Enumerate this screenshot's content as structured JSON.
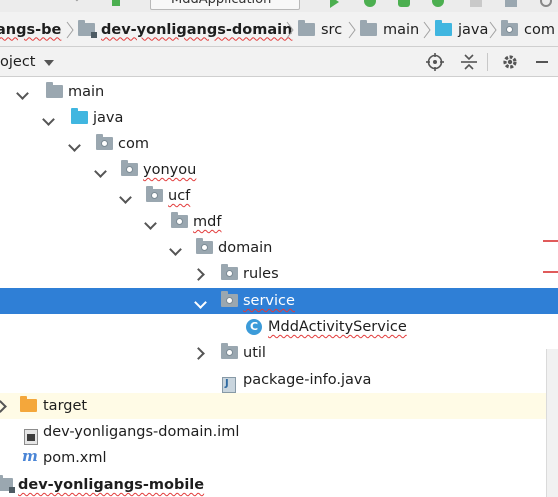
{
  "toolbar": {
    "run_config": "MddApplication"
  },
  "breadcrumb": {
    "items": [
      "angs-be",
      "dev-yonligangs-domain",
      "src",
      "main",
      "java",
      "com"
    ]
  },
  "project_panel": {
    "title": "oject",
    "actions": [
      "crosshair-icon",
      "collapse-icon",
      "gear-icon",
      "hide-icon"
    ]
  },
  "tree": {
    "rows": [
      {
        "label": "main",
        "expanded": true
      },
      {
        "label": "java",
        "expanded": true
      },
      {
        "label": "com",
        "expanded": true
      },
      {
        "label": "yonyou",
        "expanded": true
      },
      {
        "label": "ucf",
        "expanded": true
      },
      {
        "label": "mdf",
        "expanded": true
      },
      {
        "label": "domain",
        "expanded": true
      },
      {
        "label": "rules",
        "expanded": false
      },
      {
        "label": "service",
        "expanded": true,
        "selected": true
      },
      {
        "label": "MddActivityService"
      },
      {
        "label": "util",
        "expanded": false
      },
      {
        "label": "package-info.java"
      },
      {
        "label": "target",
        "expanded": false
      },
      {
        "label": "dev-yonligangs-domain.iml"
      },
      {
        "label": "pom.xml"
      },
      {
        "label": "dev-yonligangs-mobile"
      }
    ]
  },
  "colors": {
    "selection": "#2f7fd6",
    "source_folder": "#40b6e0",
    "excluded_folder": "#f4a73b",
    "error_underline": "#e23b3b"
  }
}
